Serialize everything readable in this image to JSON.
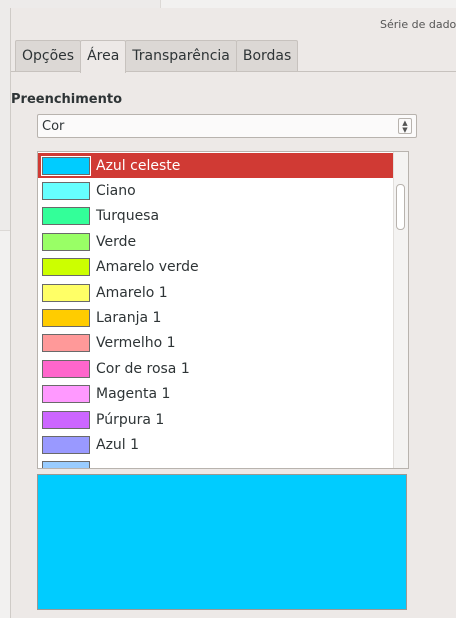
{
  "window": {
    "title": "Série de dados"
  },
  "tabs": [
    {
      "label": "Opções",
      "active": false
    },
    {
      "label": "Área",
      "active": true
    },
    {
      "label": "Transparência",
      "active": false
    },
    {
      "label": "Bordas",
      "active": false
    }
  ],
  "fill": {
    "section_label": "Preenchimento",
    "type_value": "Cor",
    "selected_color": "Azul celeste",
    "preview_color": "#00ccff"
  },
  "colors": [
    {
      "label": "Azul celeste",
      "hex": "#00ccff",
      "selected": true
    },
    {
      "label": "Ciano",
      "hex": "#66ffff",
      "selected": false
    },
    {
      "label": "Turquesa",
      "hex": "#33ff99",
      "selected": false
    },
    {
      "label": "Verde",
      "hex": "#99ff66",
      "selected": false
    },
    {
      "label": "Amarelo verde",
      "hex": "#ccff00",
      "selected": false
    },
    {
      "label": "Amarelo 1",
      "hex": "#ffff66",
      "selected": false
    },
    {
      "label": "Laranja 1",
      "hex": "#ffcc00",
      "selected": false
    },
    {
      "label": "Vermelho 1",
      "hex": "#ff9999",
      "selected": false
    },
    {
      "label": "Cor de rosa 1",
      "hex": "#ff66cc",
      "selected": false
    },
    {
      "label": "Magenta 1",
      "hex": "#ff99ff",
      "selected": false
    },
    {
      "label": "Púrpura 1",
      "hex": "#cc66ff",
      "selected": false
    },
    {
      "label": "Azul 1",
      "hex": "#9999ff",
      "selected": false
    },
    {
      "label": "",
      "hex": "#99ccff",
      "selected": false
    }
  ],
  "accent": {
    "selection": "#d03a34"
  }
}
